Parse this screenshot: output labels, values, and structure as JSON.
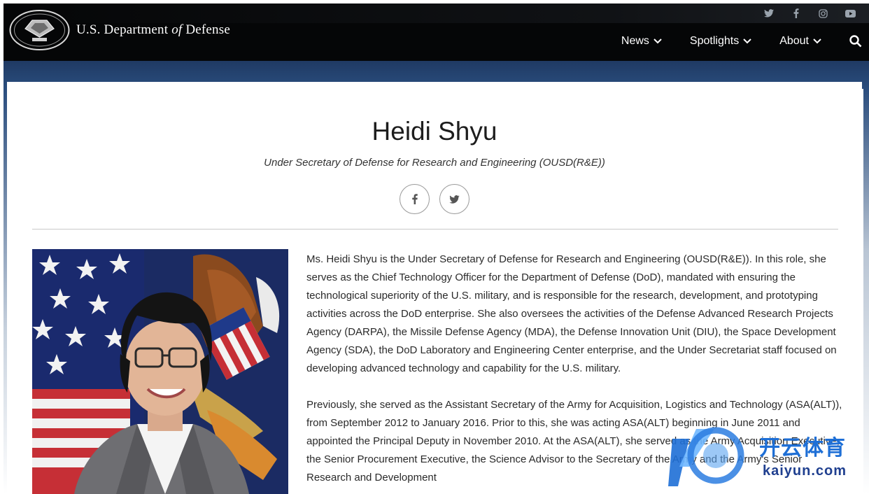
{
  "header": {
    "brand_prefix": "U.S. Department",
    "brand_of": "of",
    "brand_suffix": "Defense",
    "social": [
      "twitter-icon",
      "facebook-icon",
      "instagram-icon",
      "youtube-icon"
    ],
    "nav": [
      {
        "label": "News"
      },
      {
        "label": "Spotlights"
      },
      {
        "label": "About"
      }
    ]
  },
  "profile": {
    "name": "Heidi Shyu",
    "title": "Under Secretary of Defense for Research and Engineering (OUSD(R&E))",
    "share": [
      "facebook-icon",
      "twitter-icon"
    ]
  },
  "bio": {
    "paragraph1": "Ms. Heidi Shyu is the Under Secretary of Defense for Research and Engineering (OUSD(R&E)). In this role, she serves as the Chief Technology Officer for the Department of Defense (DoD), mandated with ensuring the technological superiority of the U.S. military, and is responsible for the research, development, and prototyping activities across the DoD enterprise. She also oversees the activities of the Defense Advanced Research Projects Agency (DARPA), the Missile Defense Agency (MDA), the Defense Innovation Unit (DIU), the Space Development Agency (SDA), the DoD Laboratory and Engineering Center enterprise, and the Under Secretariat staff focused on developing advanced technology and capability for the U.S. military.",
    "paragraph2": "Previously, she served as the Assistant Secretary of the Army for Acquisition, Logistics and Technology (ASA(ALT)), from September 2012 to January 2016. Prior to this, she was acting ASA(ALT) beginning in June 2011 and appointed the Principal Deputy in November 2010. At the ASA(ALT), she served as the Army Acquisition Executive, the Senior Procurement Executive, the Science Advisor to the Secretary of the Army and the Army's Senior Research and Development"
  },
  "watermark": {
    "text": "开云体育",
    "url": "kaiyun.com"
  },
  "colors": {
    "header_bg": "#050607",
    "band": "#2a4d7e",
    "watermark_blue": "#1e6fd6"
  }
}
